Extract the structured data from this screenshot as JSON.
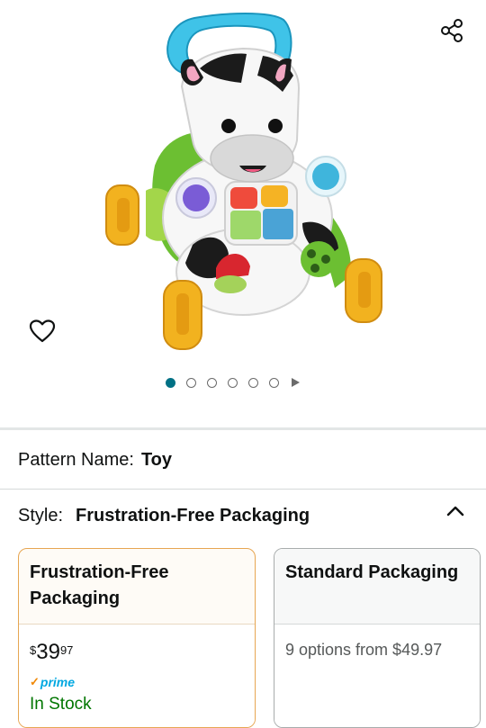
{
  "gallery": {
    "image_alt": "",
    "dots_total": 6,
    "active_dot": 1
  },
  "variations": {
    "pattern": {
      "label": "Pattern Name:",
      "value": "Toy"
    },
    "style": {
      "label": "Style:",
      "value": "Frustration-Free Packaging"
    }
  },
  "options": [
    {
      "title": "Frustration-Free Packaging",
      "selected": true,
      "price": {
        "symbol": "$",
        "whole": "39",
        "fraction": "97"
      },
      "prime": "prime",
      "stock": "In Stock"
    },
    {
      "title": "Standard Packaging",
      "selected": false,
      "summary": "9 options from $49.97"
    }
  ],
  "colors": {
    "accent": "#007185",
    "selected_border": "#e7a652",
    "in_stock": "#007600",
    "prime_blue": "#00a8e1",
    "prime_orange": "#f08804"
  },
  "icons": {
    "share": "share-icon",
    "wishlist": "heart-icon",
    "collapse": "chevron-up-icon",
    "next": "play-icon"
  }
}
